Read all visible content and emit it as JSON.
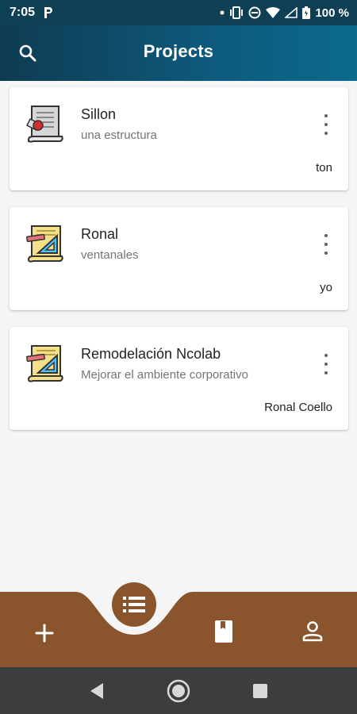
{
  "status_bar": {
    "time": "7:05",
    "battery": "100 %"
  },
  "app_bar": {
    "title": "Projects"
  },
  "projects": [
    {
      "title": "Sillon",
      "subtitle": "una estructura",
      "owner": "ton",
      "icon": "document-stamp-icon"
    },
    {
      "title": "Ronal",
      "subtitle": "ventanales",
      "owner": "yo",
      "icon": "blueprint-icon"
    },
    {
      "title": "Remodelación Ncolab",
      "subtitle": "Mejorar el ambiente corporativo",
      "owner": "Ronal Coello",
      "icon": "blueprint-icon"
    }
  ],
  "bottom_nav": {
    "items": [
      "add-icon",
      "list-icon",
      "book-icon",
      "person-icon"
    ]
  },
  "colors": {
    "app_bar": "#0d5a7c",
    "bottom_nav": "#8a552c",
    "system_nav": "#3b3d3e"
  }
}
